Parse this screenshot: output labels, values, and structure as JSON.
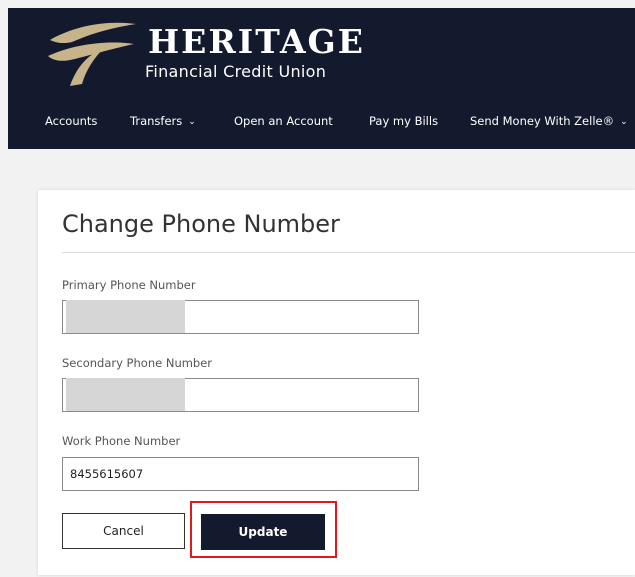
{
  "header": {
    "brand_name": "HERITAGE",
    "brand_sub": "Financial Credit Union",
    "logo_icon": "swoosh-logo-icon",
    "background_color": "#141a2e",
    "logo_color": "#c8b48a"
  },
  "nav": {
    "items": [
      {
        "label": "Accounts",
        "has_dropdown": false
      },
      {
        "label": "Transfers",
        "has_dropdown": true
      },
      {
        "label": "Open an Account",
        "has_dropdown": false
      },
      {
        "label": "Pay my Bills",
        "has_dropdown": false
      },
      {
        "label": "Send Money With Zelle®",
        "has_dropdown": true
      }
    ],
    "dropdown_icon": "chevron-down-icon",
    "dropdown_glyph": "⌄"
  },
  "form": {
    "title": "Change Phone Number",
    "fields": [
      {
        "label": "Primary Phone Number",
        "value": "",
        "redacted": true
      },
      {
        "label": "Secondary Phone Number",
        "value": "",
        "redacted": true
      },
      {
        "label": "Work Phone Number",
        "value": "8455615607",
        "redacted": false
      }
    ],
    "cancel_label": "Cancel",
    "update_label": "Update",
    "highlight_color": "#e0191e"
  }
}
